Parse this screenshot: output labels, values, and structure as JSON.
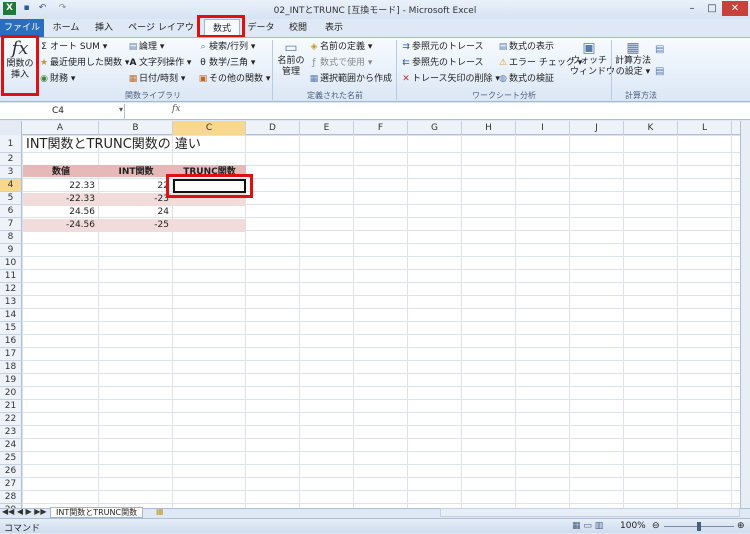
{
  "app": {
    "title": "02_INTとTRUNC  [互換モード] - Microsoft Excel"
  },
  "tabs": [
    "ファイル",
    "ホーム",
    "挿入",
    "ページ レイアウト",
    "数式",
    "データ",
    "校閲",
    "表示"
  ],
  "ribbon": {
    "insert_function": [
      "関数の",
      "挿入"
    ],
    "library": {
      "autosum": "オート SUM",
      "recent": "最近使用した関数",
      "financial": "財務",
      "logical": "論理",
      "text": "文字列操作",
      "datetime": "日付/時刻",
      "lookup": "検索/行列",
      "math": "数学/三角",
      "more": "その他の関数",
      "group": "関数ライブラリ"
    },
    "names": {
      "manager": [
        "名前の",
        "管理"
      ],
      "define": "名前の定義",
      "use": "数式で使用",
      "create": "選択範囲から作成",
      "group": "定義された名前"
    },
    "audit": {
      "precedents": "参照元のトレース",
      "dependents": "参照先のトレース",
      "remove": "トレース矢印の削除",
      "show": "数式の表示",
      "error": "エラー チェック",
      "evaluate": "数式の検証",
      "watch": [
        "ウォッチ",
        "ウィンドウ"
      ],
      "group": "ワークシート分析"
    },
    "calc": {
      "options": [
        "計算方法",
        "の設定"
      ],
      "group": "計算方法"
    }
  },
  "namebox": "C4",
  "fx": "fx",
  "columns": [
    "A",
    "B",
    "C",
    "D",
    "E",
    "F",
    "G",
    "H",
    "I",
    "J",
    "K",
    "L"
  ],
  "rows": [
    "1",
    "2",
    "3",
    "4",
    "5",
    "6",
    "7",
    "8",
    "9",
    "10",
    "11",
    "12",
    "13",
    "14",
    "15",
    "16",
    "17",
    "18",
    "19",
    "20",
    "21",
    "22",
    "23",
    "24",
    "25",
    "26",
    "27",
    "28",
    "29"
  ],
  "sheet": {
    "title": "INT関数とTRUNC関数の 違い",
    "headers": [
      "数値",
      "INT関数",
      "TRUNC関数"
    ],
    "values": [
      "22.33",
      "-22.33",
      "24.56",
      "-24.56"
    ],
    "int": [
      "22",
      "-23",
      "24",
      "-25"
    ]
  },
  "sheet_tab": "INT関数とTRUNC関数",
  "status": {
    "mode": "コマンド",
    "zoom": "100%"
  }
}
